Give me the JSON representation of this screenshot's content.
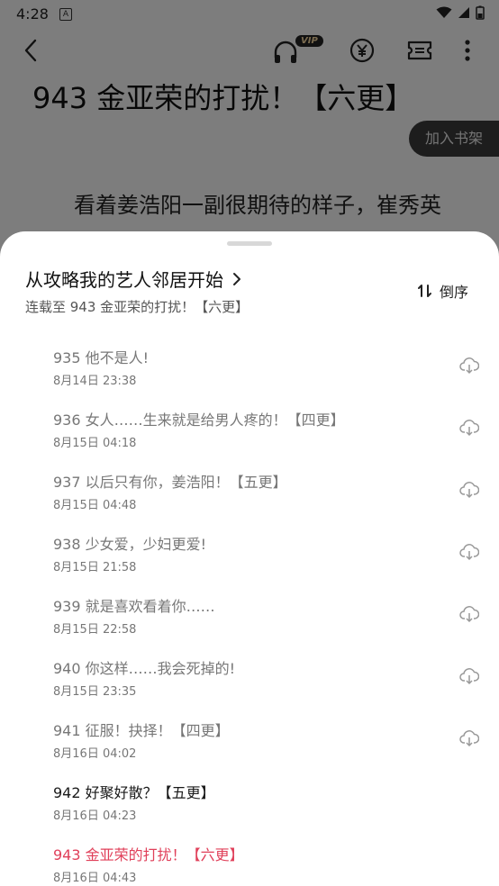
{
  "status": {
    "time": "4:28",
    "notification_letter": "A"
  },
  "toolbar": {
    "vip_badge": "VIP"
  },
  "reader": {
    "chapter_title": "943 金亚荣的打扰！【六更】",
    "add_shelf_label": "加入书架",
    "first_line": "看着姜浩阳一副很期待的样子，崔秀英"
  },
  "sheet": {
    "book_title": "从攻略我的艺人邻居开始",
    "subtitle": "连载至 943 金亚荣的打扰！【六更】",
    "sort_label": "倒序",
    "chapters": [
      {
        "title": "935 他不是人!",
        "date": "8月14日 23:38"
      },
      {
        "title": "936 女人……生来就是给男人疼的！【四更】",
        "date": "8月15日 04:18"
      },
      {
        "title": "937 以后只有你，姜浩阳！【五更】",
        "date": "8月15日 04:48"
      },
      {
        "title": "938 少女爱，少妇更爱!",
        "date": "8月15日 21:58"
      },
      {
        "title": "939 就是喜欢看着你……",
        "date": "8月15日 22:58"
      },
      {
        "title": "940 你这样……我会死掉的!",
        "date": "8月15日 23:35"
      },
      {
        "title": "941 征服！抉择！【四更】",
        "date": "8月16日 04:02"
      },
      {
        "title": "942 好聚好散？【五更】",
        "date": "8月16日 04:23"
      },
      {
        "title": "943 金亚荣的打扰！【六更】",
        "date": "8月16日 04:43"
      }
    ]
  },
  "colors": {
    "current_chapter": "#e0405a",
    "overlay": "rgba(0,0,0,0.5)"
  }
}
